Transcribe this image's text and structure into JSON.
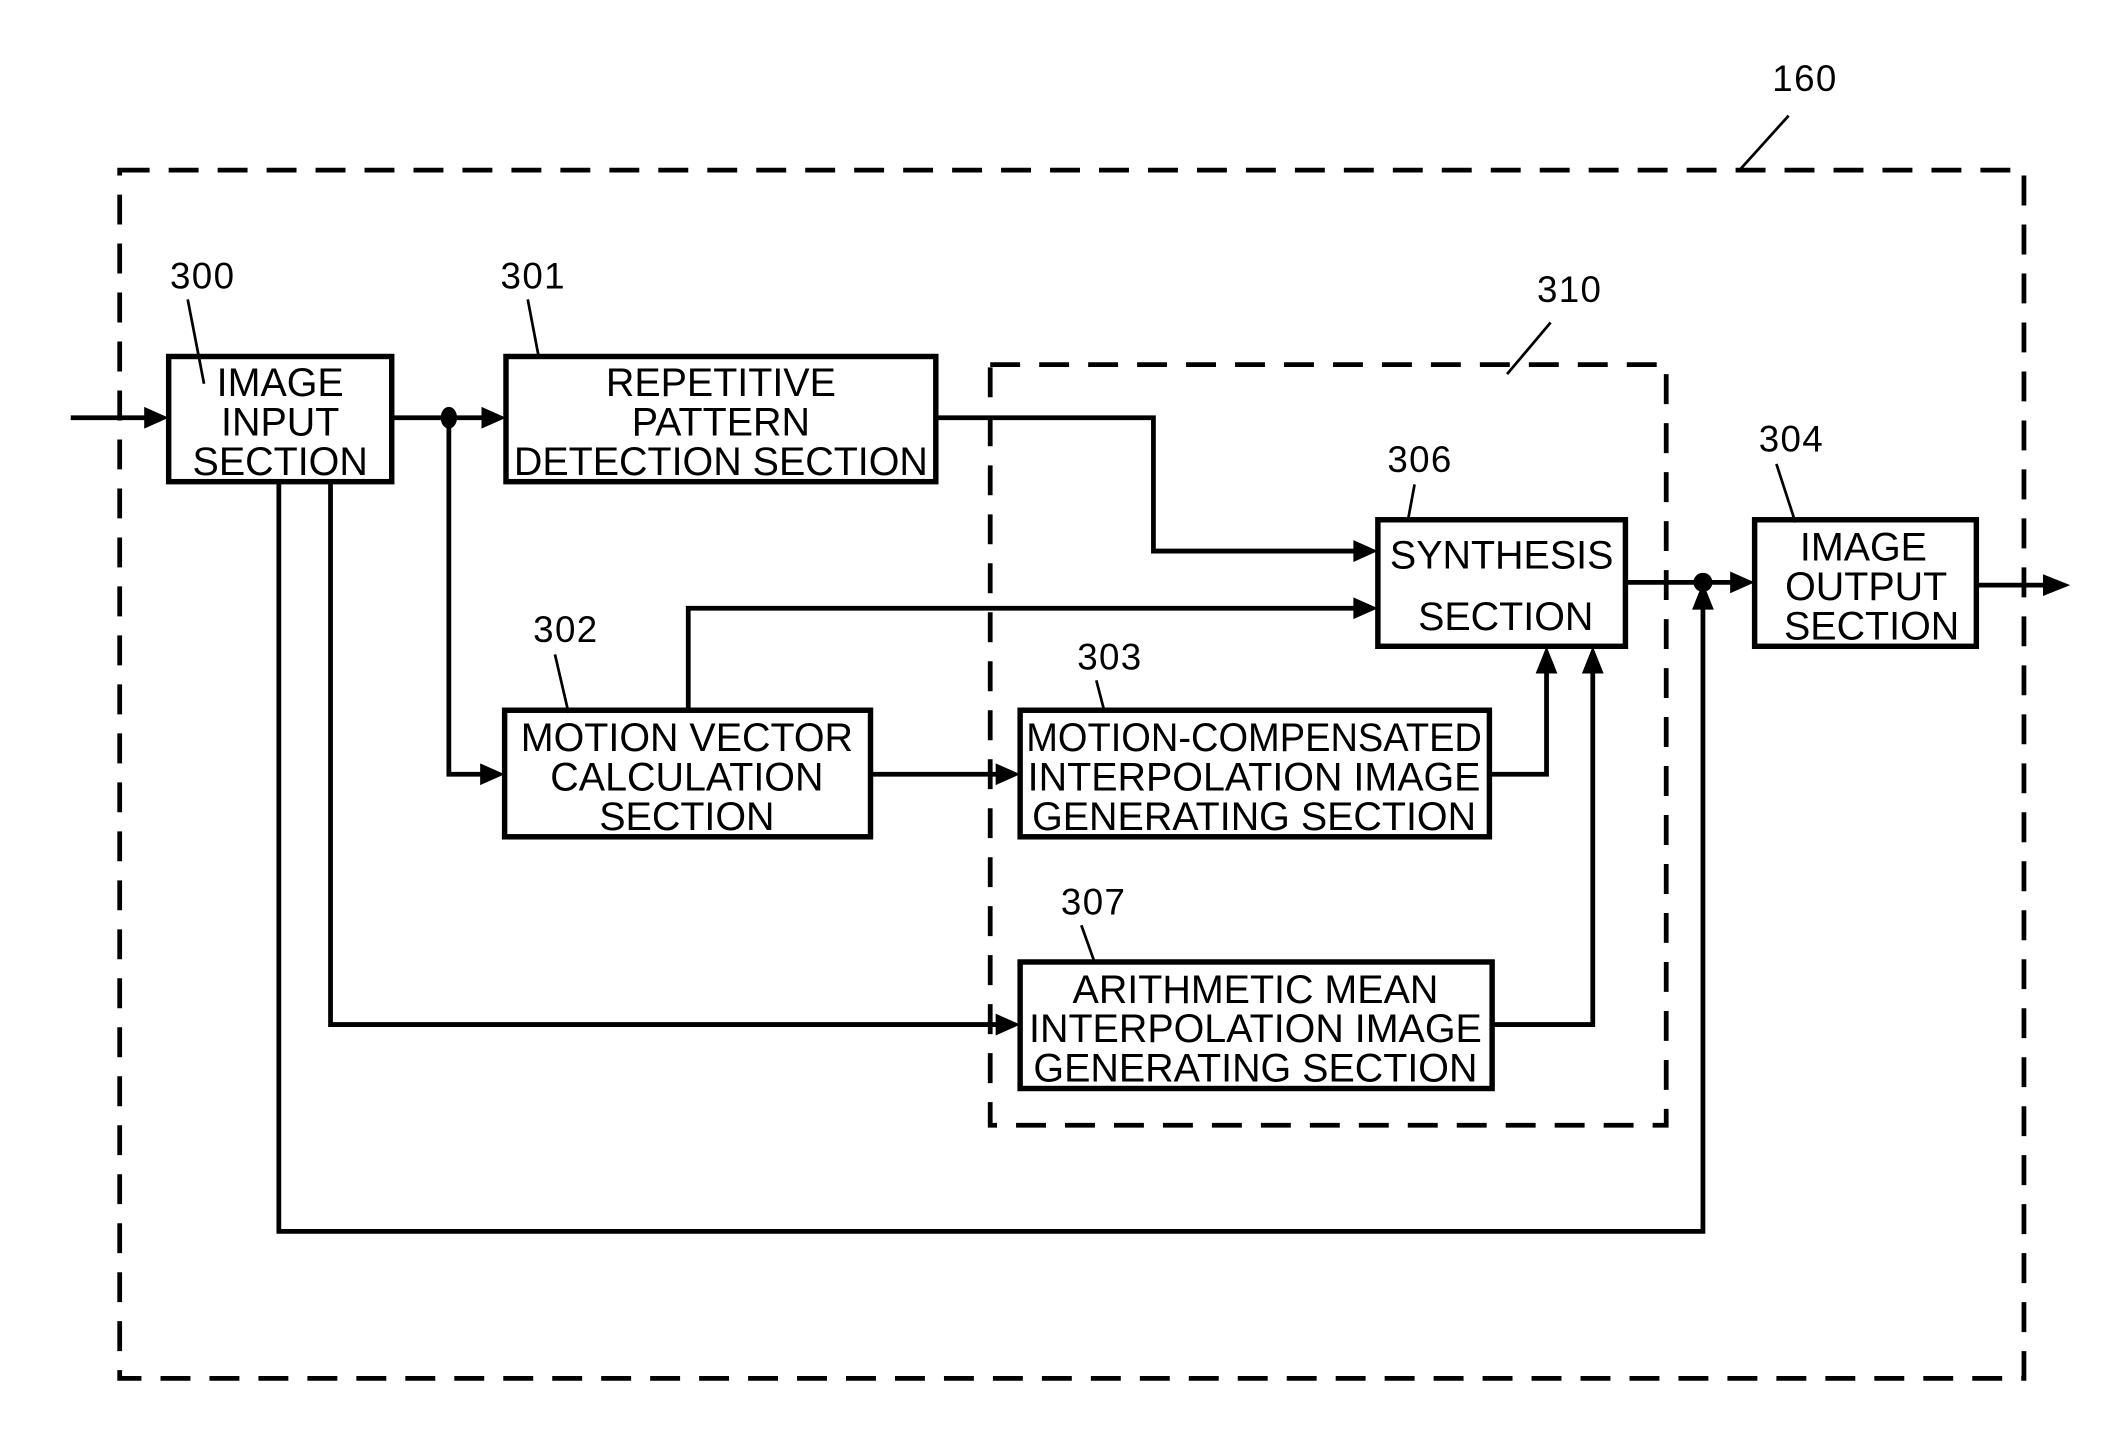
{
  "diagram": {
    "container": {
      "ref": "160"
    },
    "group": {
      "ref": "310"
    },
    "blocks": {
      "image_input": {
        "ref": "300",
        "lines": [
          "IMAGE",
          "INPUT",
          "SECTION"
        ]
      },
      "repetitive_pattern": {
        "ref": "301",
        "lines": [
          "REPETITIVE",
          "PATTERN",
          "DETECTION SECTION"
        ]
      },
      "motion_vector": {
        "ref": "302",
        "lines": [
          "MOTION VECTOR",
          "CALCULATION",
          "SECTION"
        ]
      },
      "motion_compensated": {
        "ref": "303",
        "lines": [
          "MOTION-COMPENSATED",
          "INTERPOLATION IMAGE",
          "GENERATING SECTION"
        ]
      },
      "image_output": {
        "ref": "304",
        "lines": [
          "IMAGE",
          "OUTPUT",
          "SECTION"
        ]
      },
      "synthesis": {
        "ref": "306",
        "lines": [
          "SYNTHESIS",
          "SECTION"
        ]
      },
      "arithmetic_mean": {
        "ref": "307",
        "lines": [
          "ARITHMETIC MEAN",
          "INTERPOLATION IMAGE",
          "GENERATING SECTION"
        ]
      }
    }
  }
}
